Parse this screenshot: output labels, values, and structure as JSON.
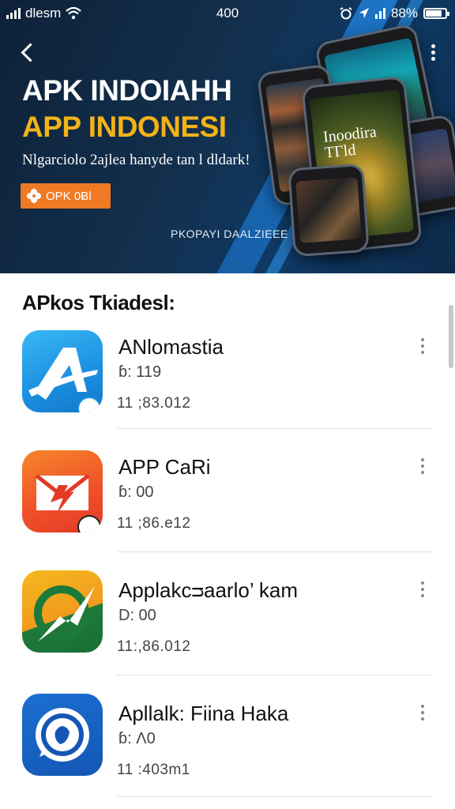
{
  "status_bar": {
    "carrier": "dlesm",
    "time": "400",
    "battery": "88%"
  },
  "hero": {
    "title_line1": "APK INDOIAHH",
    "title_line2": "APP INDONESI",
    "subtitle": "Nlgarciolo 2ajlea hanyde tan l dldark!",
    "button_label": "OPK 0Ƀl",
    "caption": "PKOPAYI DAALZIEEE",
    "phone_screen_title": "Inoodira TГld"
  },
  "section": {
    "title": "APkos Tkiadesl:"
  },
  "apps": [
    {
      "name": "ANlomastia",
      "meta": "ɓ: 119",
      "date": "11 ;83.012",
      "icon": "a-arrow-icon",
      "color": "#1a8fe0"
    },
    {
      "name": "APP CaRi",
      "meta": "ɓ: 00",
      "date": "11 ;86.e12",
      "icon": "envelope-bolt-icon",
      "color": "#ef4f2a"
    },
    {
      "name": "Applakcᴝaarlo’ kam",
      "meta": "D: 00",
      "date": "11:,86.012",
      "icon": "leaf-arrow-icon",
      "color": "#f29a1e"
    },
    {
      "name": "Apllalk: Fiina Haka",
      "meta": "ɓ: Ʌ0",
      "date": "11 :403m1",
      "icon": "chat-bubble-icon",
      "color": "#1456b5"
    }
  ]
}
